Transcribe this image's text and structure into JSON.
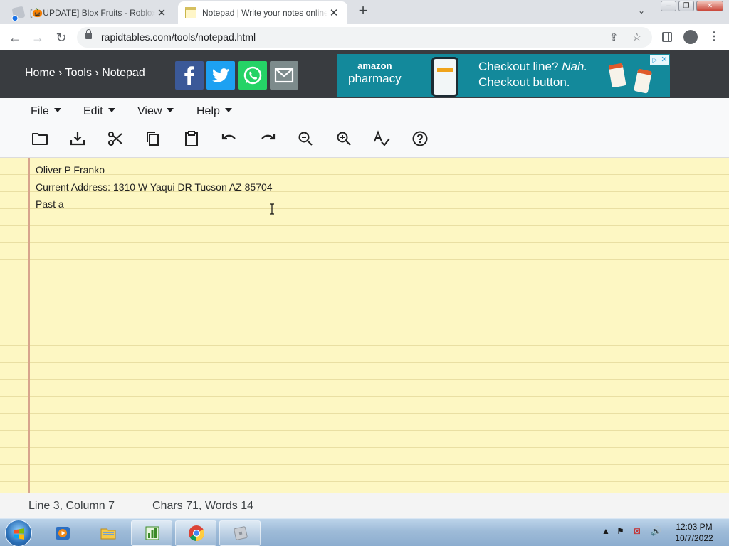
{
  "browser": {
    "tabs": [
      {
        "title": "[🎃UPDATE] Blox Fruits - Roblox",
        "active": false,
        "favicon": "roblox-icon"
      },
      {
        "title": "Notepad | Write your notes online",
        "active": true,
        "favicon": "notepad-icon"
      }
    ],
    "new_tab_glyph": "+",
    "url": "rapidtables.com/tools/notepad.html"
  },
  "site": {
    "breadcrumb": {
      "home": "Home",
      "tools": "Tools",
      "current": "Notepad",
      "separator": "›"
    },
    "share_icons": [
      "facebook-icon",
      "twitter-icon",
      "whatsapp-icon",
      "email-icon"
    ],
    "ad": {
      "brand_top": "amazon",
      "brand_bottom": "pharmacy",
      "line1_a": "Checkout line? ",
      "line1_b": "Nah.",
      "line2": "Checkout button."
    }
  },
  "app": {
    "menus": [
      {
        "label": "File"
      },
      {
        "label": "Edit"
      },
      {
        "label": "View"
      },
      {
        "label": "Help"
      }
    ],
    "toolbar": [
      "open-icon",
      "save-icon",
      "cut-icon",
      "copy-icon",
      "paste-icon",
      "undo-icon",
      "redo-icon",
      "zoom-out-icon",
      "zoom-in-icon",
      "spellcheck-icon",
      "help-icon"
    ]
  },
  "editor": {
    "lines": [
      "Oliver P Franko",
      "Current Address: 1310 W Yaqui DR Tucson AZ 85704",
      "Past a"
    ],
    "colors": {
      "paper": "#fdf7c3",
      "rule": "#e9dfa3",
      "margin": "#d7a48d"
    }
  },
  "status": {
    "position": "Line 3, Column 7",
    "counts": "Chars 71, Words 14"
  },
  "taskbar": {
    "time": "12:03 PM",
    "date": "10/7/2022"
  },
  "colors": {
    "site_header": "#393c40",
    "ad_bg": "#13899b",
    "facebook": "#3b5998",
    "twitter": "#1da1f2",
    "whatsapp": "#25d366",
    "email": "#7d8b8c"
  }
}
